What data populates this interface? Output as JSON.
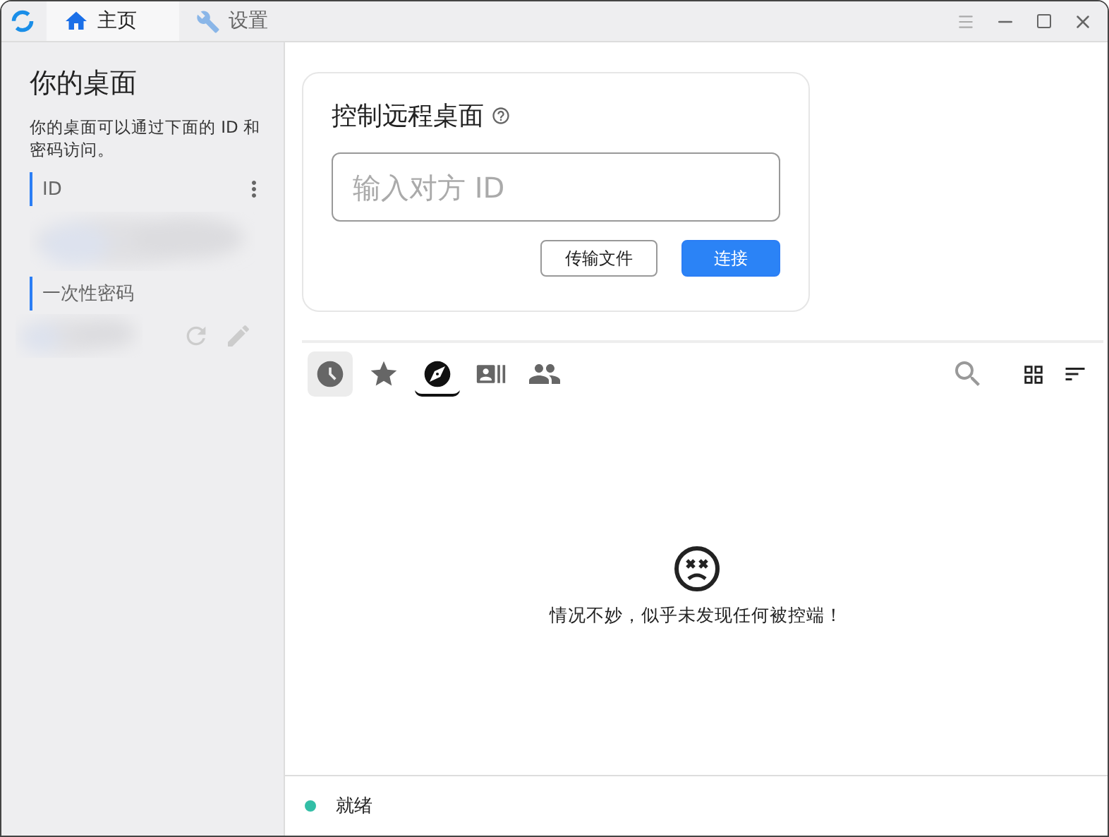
{
  "title_bar": {
    "tabs": [
      {
        "label": "主页",
        "kind": "home",
        "selected": true
      },
      {
        "label": "设置",
        "kind": "settings",
        "selected": false
      }
    ]
  },
  "sidebar": {
    "title": "你的桌面",
    "description": "你的桌面可以通过下面的 ID 和密码访问。",
    "id_label": "ID",
    "password_label": "一次性密码"
  },
  "connect_card": {
    "title": "控制远程桌面",
    "placeholder": "输入对方 ID",
    "buttons": [
      {
        "label": "传输文件",
        "kind": "secondary"
      },
      {
        "label": "连接",
        "kind": "primary"
      }
    ]
  },
  "peer_tabs": [
    {
      "kind": "recent",
      "selected": false,
      "hovered": true
    },
    {
      "kind": "favorites",
      "selected": false,
      "hovered": false
    },
    {
      "kind": "discovered",
      "selected": true,
      "hovered": false
    },
    {
      "kind": "address-book",
      "selected": false,
      "hovered": false
    },
    {
      "kind": "group",
      "selected": false,
      "hovered": false
    }
  ],
  "empty_message": "情况不妙，似乎未发现任何被控端！",
  "status_bar": {
    "text": "就绪",
    "color": "#32bea6"
  }
}
